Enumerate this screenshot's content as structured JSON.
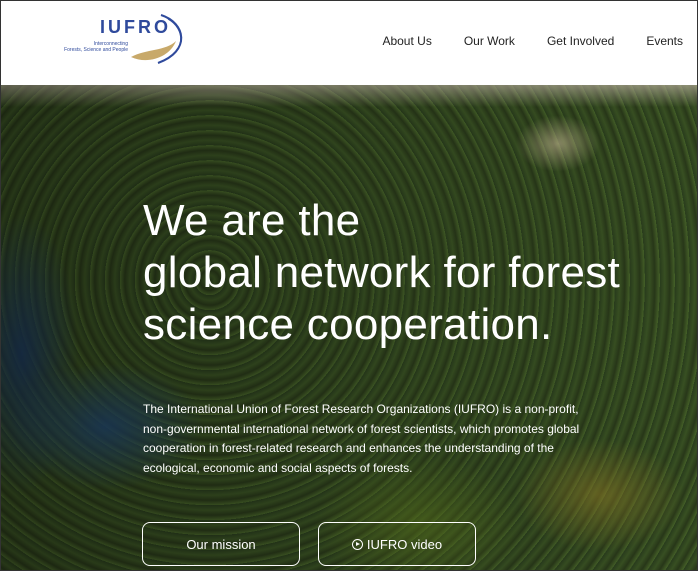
{
  "header": {
    "logo_text": "IUFRO",
    "logo_tagline_1": "Interconnecting",
    "logo_tagline_2": "Forests, Science and People",
    "nav": [
      {
        "label": "About Us"
      },
      {
        "label": "Our Work"
      },
      {
        "label": "Get Involved"
      },
      {
        "label": "Events"
      }
    ]
  },
  "hero": {
    "title_line_1": "We are the",
    "title_line_2": "global network for forest",
    "title_line_3": "science cooperation.",
    "description": "The International Union of Forest Research Organizations (IUFRO) is a non-profit, non-governmental international network of forest scientists, which promotes global cooperation in forest-related research and enhances the understanding of the ecological, economic and social aspects of forests.",
    "primary_button": "Our mission",
    "secondary_button": "IUFRO video",
    "secondary_button_icon": "play-circle-icon"
  },
  "colors": {
    "brand_blue": "#2f4a9c",
    "brand_gold": "#c8a96a"
  }
}
